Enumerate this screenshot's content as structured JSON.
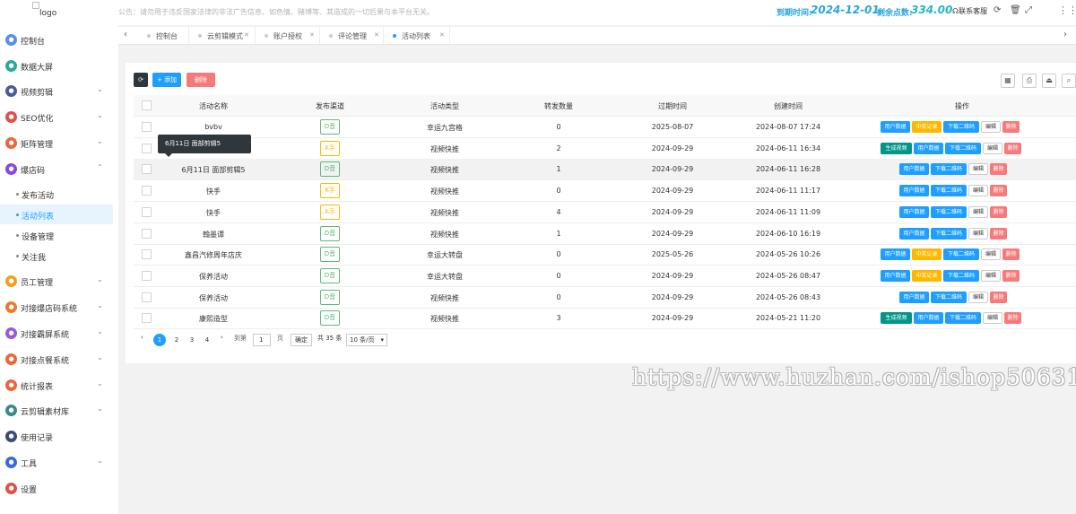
{
  "header": {
    "logo_alt": "logo",
    "notice": "公告：请勿用于违反国家法律的非法广告信息、如色情、赌博等、其造成的一切后果与本平台无关。",
    "expire_label": "到期时间:",
    "expire_value": "2024-12-01",
    "points_label": "剩余点数:",
    "points_value": "334.00",
    "contact": "联系客服"
  },
  "sidebar": {
    "items": [
      {
        "label": "控制台",
        "icon": "dashboard-icon",
        "color": "#5b8def"
      },
      {
        "label": "数据大屏",
        "icon": "screen-icon",
        "color": "#2aa899"
      },
      {
        "label": "视频剪辑",
        "icon": "video-icon",
        "color": "#4a5a9a"
      },
      {
        "label": "SEO优化",
        "icon": "seo-icon",
        "color": "#e0504a"
      },
      {
        "label": "矩阵管理",
        "icon": "matrix-icon",
        "color": "#f0643c"
      },
      {
        "label": "爆店码",
        "icon": "shop-code-icon",
        "color": "#8a4ad8"
      },
      {
        "label": "员工管理",
        "icon": "staff-icon",
        "color": "#f0a020"
      },
      {
        "label": "对接爆店码系统",
        "icon": "link-icon",
        "color": "#f07a2a"
      },
      {
        "label": "对接霸屏系统",
        "icon": "screen-link-icon",
        "color": "#9a5ad8"
      },
      {
        "label": "对接点餐系统",
        "icon": "order-icon",
        "color": "#f0643c"
      },
      {
        "label": "统计报表",
        "icon": "report-icon",
        "color": "#f0643c"
      },
      {
        "label": "云剪辑素材库",
        "icon": "cloud-icon",
        "color": "#3a8a8a"
      },
      {
        "label": "使用记录",
        "icon": "history-icon",
        "color": "#3a4a7a"
      },
      {
        "label": "工具",
        "icon": "tool-icon",
        "color": "#3a6ad8"
      },
      {
        "label": "设置",
        "icon": "settings-icon",
        "color": "#e0504a"
      }
    ],
    "sub_items": [
      "发布活动",
      "活动列表",
      "设备管理",
      "关注我"
    ]
  },
  "tabs": [
    "控制台",
    "云剪辑模式",
    "账户授权",
    "评论管理",
    "活动列表"
  ],
  "toolbar": {
    "add": "+ 添加",
    "delete": "删除"
  },
  "table": {
    "columns": [
      "活动名称",
      "发布渠道",
      "活动类型",
      "转发数量",
      "过期时间",
      "创建时间",
      "操作"
    ],
    "rows": [
      {
        "name": "bvbv",
        "channel": "D音",
        "type": "幸运九宫格",
        "count": "0",
        "expire": "2025-08-07",
        "created": "2024-08-07 17:24",
        "ops": [
          "用户数据",
          "中奖记录",
          "下载二维码",
          "编辑",
          "删除"
        ]
      },
      {
        "name": "",
        "channel": "K手",
        "type": "视频快推",
        "count": "2",
        "expire": "2024-09-29",
        "created": "2024-06-11 16:34",
        "ops": [
          "生成视频",
          "用户数据",
          "下载二维码",
          "编辑",
          "删除"
        ]
      },
      {
        "name": "6月11日 面部剪辑5",
        "channel": "D音",
        "type": "视频快推",
        "count": "1",
        "expire": "2024-09-29",
        "created": "2024-06-11 16:28",
        "ops": [
          "用户数据",
          "下载二维码",
          "编辑",
          "删除"
        ]
      },
      {
        "name": "快手",
        "channel": "K手",
        "type": "视频快推",
        "count": "0",
        "expire": "2024-09-29",
        "created": "2024-06-11 11:17",
        "ops": [
          "用户数据",
          "下载二维码",
          "编辑",
          "删除"
        ]
      },
      {
        "name": "快手",
        "channel": "K手",
        "type": "视频快推",
        "count": "4",
        "expire": "2024-09-29",
        "created": "2024-06-11 11:09",
        "ops": [
          "用户数据",
          "下载二维码",
          "编辑",
          "删除"
        ]
      },
      {
        "name": "翰墨谭",
        "channel": "D音",
        "type": "视频快推",
        "count": "1",
        "expire": "2024-09-29",
        "created": "2024-06-10 16:19",
        "ops": [
          "用户数据",
          "下载二维码",
          "编辑",
          "删除"
        ]
      },
      {
        "name": "鑫昌汽修周年店庆",
        "channel": "D音",
        "type": "幸运大转盘",
        "count": "0",
        "expire": "2025-05-26",
        "created": "2024-05-26 10:26",
        "ops": [
          "用户数据",
          "中奖记录",
          "下载二维码",
          "编辑",
          "删除"
        ]
      },
      {
        "name": "保养活动",
        "channel": "D音",
        "type": "幸运大转盘",
        "count": "0",
        "expire": "2024-09-29",
        "created": "2024-05-26 08:47",
        "ops": [
          "用户数据",
          "中奖记录",
          "下载二维码",
          "编辑",
          "删除"
        ]
      },
      {
        "name": "保养活动",
        "channel": "D音",
        "type": "视频快推",
        "count": "0",
        "expire": "2024-09-29",
        "created": "2024-05-26 08:43",
        "ops": [
          "用户数据",
          "下载二维码",
          "编辑",
          "删除"
        ]
      },
      {
        "name": "康熙造型",
        "channel": "D音",
        "type": "视频快推",
        "count": "3",
        "expire": "2024-09-29",
        "created": "2024-05-21 11:20",
        "ops": [
          "生成视频",
          "用户数据",
          "下载二维码",
          "编辑",
          "删除"
        ]
      }
    ]
  },
  "tooltip": "6月11日 面部剪辑5",
  "pagination": {
    "pages": [
      "1",
      "2",
      "3",
      "4"
    ],
    "goto_label": "到第",
    "page_input": "1",
    "page_suffix": "页",
    "confirm": "确定",
    "total": "共 35 条",
    "page_size": "10 条/页"
  },
  "watermark": "https://www.huzhan.com/ishop50631"
}
